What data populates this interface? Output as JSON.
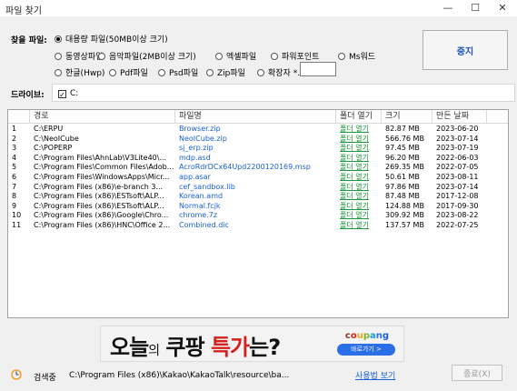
{
  "window": {
    "title": "파일 찾기",
    "minimize": "—",
    "maximize": "☐",
    "close": "✕"
  },
  "filters": {
    "label": "찾을 파일:",
    "options": [
      {
        "label": "대용량 파일(50MB이상 크기)",
        "checked": true
      },
      {
        "label": "동영상파일",
        "checked": false
      },
      {
        "label": "음악파일(2MB이상 크기)",
        "checked": false
      },
      {
        "label": "엑셀파일",
        "checked": false
      },
      {
        "label": "파워포인트",
        "checked": false
      },
      {
        "label": "Ms워드",
        "checked": false
      },
      {
        "label": "한글(Hwp)",
        "checked": false
      },
      {
        "label": "Pdf파일",
        "checked": false
      },
      {
        "label": "Psd파일",
        "checked": false
      },
      {
        "label": "Zip파일",
        "checked": false
      },
      {
        "label": "확장자 *.",
        "checked": false
      }
    ],
    "ext_value": ""
  },
  "stop_button": "중지",
  "drives": {
    "label": "드라이브:",
    "items": [
      {
        "label": "C:",
        "checked": true
      }
    ]
  },
  "table": {
    "columns": [
      "경로",
      "파일명",
      "폴더 열기",
      "크기",
      "만든 날짜"
    ],
    "rows": [
      {
        "n": "1",
        "path": "C:\\ERPU",
        "file": "Browser.zip",
        "open": "폴더 열기",
        "size": "82.87 MB",
        "date": "2023-06-20"
      },
      {
        "n": "2",
        "path": "C:\\NeoICube",
        "file": "NeoICube.zip",
        "open": "폴더 열기",
        "size": "566.76 MB",
        "date": "2023-07-14"
      },
      {
        "n": "3",
        "path": "C:\\POPERP",
        "file": "sj_erp.zip",
        "open": "폴더 열기",
        "size": "97.45 MB",
        "date": "2023-07-19"
      },
      {
        "n": "4",
        "path": "C:\\Program Files\\AhnLab\\V3Lite40\\...",
        "file": "mdp.asd",
        "open": "폴더 열기",
        "size": "96.20 MB",
        "date": "2022-06-03"
      },
      {
        "n": "5",
        "path": "C:\\Program Files\\Common Files\\Adob...",
        "file": "AcroRdrDCx64Upd2200120169.msp",
        "open": "폴더 열기",
        "size": "269.35 MB",
        "date": "2022-07-05"
      },
      {
        "n": "6",
        "path": "C:\\Program Files\\WindowsApps\\Micr...",
        "file": "app.asar",
        "open": "폴더 열기",
        "size": "50.61 MB",
        "date": "2023-08-11"
      },
      {
        "n": "7",
        "path": "C:\\Program Files (x86)\\e-branch 3...",
        "file": "cef_sandbox.lib",
        "open": "폴더 열기",
        "size": "97.86 MB",
        "date": "2023-07-14"
      },
      {
        "n": "8",
        "path": "C:\\Program Files (x86)\\ESTsoft\\ALP...",
        "file": "Korean.amd",
        "open": "폴더 열기",
        "size": "87.48 MB",
        "date": "2017-12-08"
      },
      {
        "n": "9",
        "path": "C:\\Program Files (x86)\\ESTsoft\\ALP...",
        "file": "Normal.fcjk",
        "open": "폴더 열기",
        "size": "124.88 MB",
        "date": "2017-09-30"
      },
      {
        "n": "10",
        "path": "C:\\Program Files (x86)\\Google\\Chro...",
        "file": "chrome.7z",
        "open": "폴더 열기",
        "size": "309.92 MB",
        "date": "2023-08-22"
      },
      {
        "n": "11",
        "path": "C:\\Program Files (x86)\\HNC\\Office 2...",
        "file": "Combined.dic",
        "open": "폴더 열기",
        "size": "137.57 MB",
        "date": "2022-07-25"
      }
    ]
  },
  "ad": {
    "w1": "오늘",
    "w2": "의",
    "w3": " 쿠팡 ",
    "w4": "특가",
    "w5": "는?",
    "brand": "coupang",
    "cta": "바로가기 >"
  },
  "status": {
    "label": "검색중",
    "path": "C:\\Program Files (x86)\\Kakao\\KakaoTalk\\resource\\ba...",
    "help_link": "사용법 보기",
    "end_button": "종료(X)"
  },
  "colors": {
    "link": "#1a5fd6",
    "folder_open": "#1d9a3c",
    "stop_text": "#1f4fbf",
    "coupang_btn": "#2a6ee8",
    "ad_red": "#d7201d"
  }
}
